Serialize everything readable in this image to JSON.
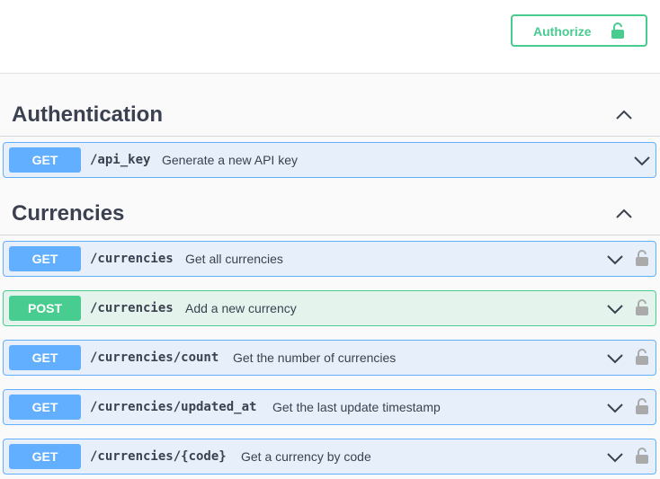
{
  "header": {
    "authorize_label": "Authorize"
  },
  "sections": [
    {
      "title": "Authentication",
      "operations": [
        {
          "method": "GET",
          "path": "/api_key",
          "summary": "Generate a new API key",
          "locked": false
        }
      ]
    },
    {
      "title": "Currencies",
      "operations": [
        {
          "method": "GET",
          "path": "/currencies",
          "summary": "Get all currencies",
          "locked": true
        },
        {
          "method": "POST",
          "path": "/currencies",
          "summary": "Add a new currency",
          "locked": true
        },
        {
          "method": "GET",
          "path": "/currencies/count",
          "summary": "Get the number of currencies",
          "locked": true
        },
        {
          "method": "GET",
          "path": "/currencies/updated_at",
          "summary": "Get the last update timestamp",
          "locked": true
        },
        {
          "method": "GET",
          "path": "/currencies/{code}",
          "summary": "Get a currency by code",
          "locked": true
        }
      ]
    }
  ],
  "colors": {
    "get": "#61affe",
    "post": "#49cc90",
    "authorize": "#49cc90",
    "text": "#3b4151",
    "lock_gray": "#aaaaaa"
  },
  "icons": {
    "authorize": "unlocked-padlock-icon",
    "section_toggle": "chevron-up-icon",
    "expand": "chevron-down-icon",
    "operation_lock": "unlocked-padlock-icon"
  }
}
